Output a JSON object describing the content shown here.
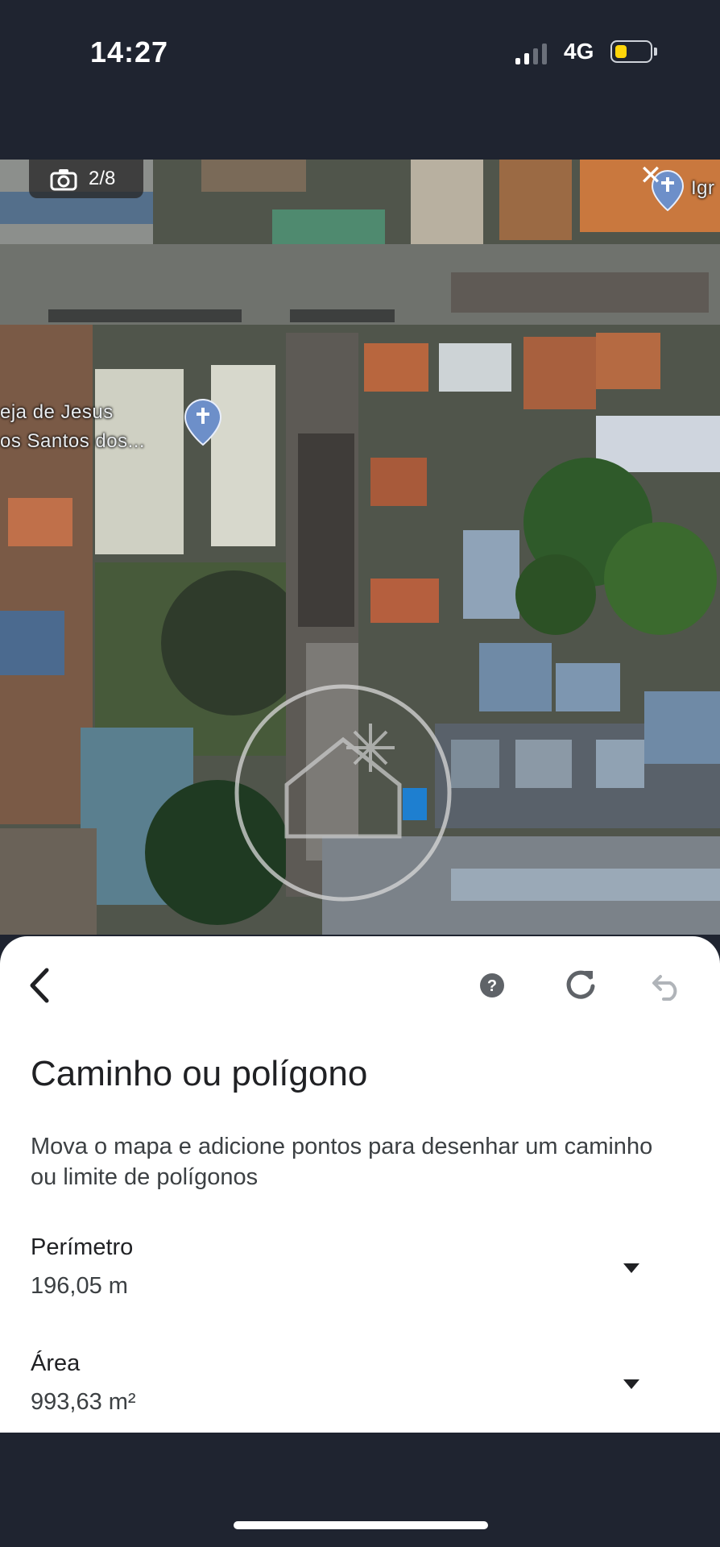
{
  "status_bar": {
    "time": "14:27",
    "network": "4G",
    "battery_level": 0.35,
    "battery_color": "#ffd60a"
  },
  "map": {
    "photo_counter": "2/8",
    "labels": {
      "church_line1": "eja de Jesus",
      "church_line2": "os Santos dos...",
      "right_label": "Igr"
    },
    "icons": [
      "camera-icon",
      "close-icon",
      "church-pin-icon",
      "home-target-icon"
    ]
  },
  "sheet": {
    "title": "Caminho ou polígono",
    "subtitle": "Mova o mapa e adicione pontos para desenhar um caminho ou limite de polígonos",
    "metrics": [
      {
        "label": "Perímetro",
        "value": "196,05 m"
      },
      {
        "label": "Área",
        "value": "993,63 m²"
      }
    ],
    "colors": {
      "text": "#202124",
      "icon": "#5f6368"
    }
  }
}
